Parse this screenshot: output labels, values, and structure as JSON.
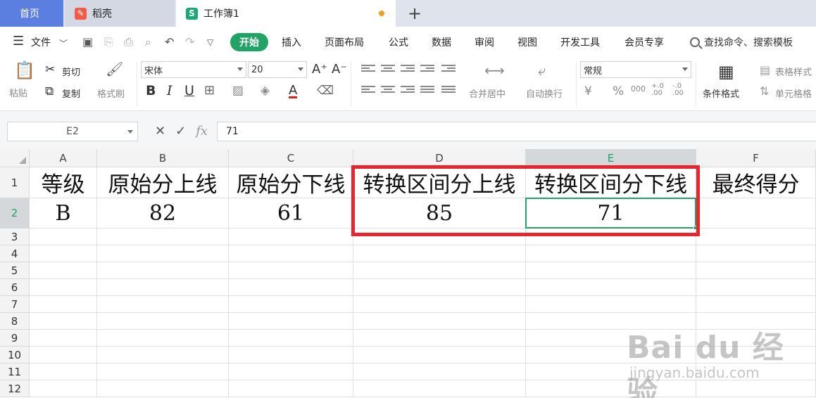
{
  "tabs": {
    "home": "首页",
    "daoke": "稻壳",
    "workbook": "工作簿1",
    "workbook_icon": "S",
    "add": "+"
  },
  "menu": {
    "file": "文件",
    "start": "开始",
    "insert": "插入",
    "page_layout": "页面布局",
    "formula": "公式",
    "data": "数据",
    "review": "审阅",
    "view": "视图",
    "dev_tools": "开发工具",
    "member": "会员专享",
    "search": "查找命令、搜索模板"
  },
  "ribbon": {
    "paste": "粘贴",
    "cut": "剪切",
    "copy": "复制",
    "format_painter": "格式刷",
    "font_name": "宋体",
    "font_size": "20",
    "merge_center": "合并居中",
    "wrap_text": "自动换行",
    "number_format": "常规",
    "conditional_format": "条件格式",
    "table_style": "表格样式",
    "cell_style": "单元格格",
    "bold": "B",
    "italic": "I",
    "underline": "U",
    "font_color": "A",
    "increase_font": "A⁺",
    "decrease_font": "A⁻",
    "currency": "¥",
    "percent": "%",
    "thousands": "000",
    "inc_decimal": "+.0 .00",
    "dec_decimal": "-.0 .00"
  },
  "formula_bar": {
    "cell_ref": "E2",
    "fx": "fx",
    "value": "71"
  },
  "columns": [
    "A",
    "B",
    "C",
    "D",
    "E",
    "F"
  ],
  "rows": [
    "1",
    "2",
    "3",
    "4",
    "5",
    "6",
    "7",
    "8",
    "9",
    "10",
    "11",
    "12"
  ],
  "sheet": {
    "header": [
      "等级",
      "原始分上线",
      "原始分下线",
      "转换区间分上线",
      "转换区间分下线",
      "最终得分"
    ],
    "row2": [
      "B",
      "82",
      "61",
      "85",
      "71",
      ""
    ]
  },
  "active_cell": "E2",
  "colors": {
    "accent": "#21a366",
    "home_tab": "#5b7fe0",
    "highlight_box": "#e8252d",
    "unsaved_dot": "#f0a020"
  },
  "watermark": {
    "brand": "Bai du 经验",
    "url": "jingyan.baidu.com"
  }
}
